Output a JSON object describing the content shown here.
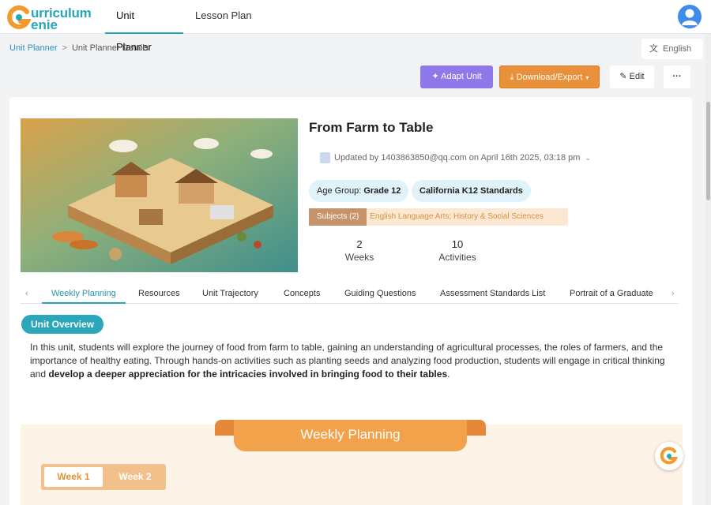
{
  "app": {
    "logo_line1": "urriculum",
    "logo_line2": "enie"
  },
  "nav": {
    "tabs": [
      {
        "label": "Unit Planner"
      },
      {
        "label": "Lesson Plan"
      }
    ]
  },
  "breadcrumb": {
    "root": "Unit Planner",
    "separator": ">",
    "current": "Unit Planner Details"
  },
  "language": {
    "label": "English"
  },
  "actions": {
    "adapt": "Adapt Unit",
    "export": "Download/Export",
    "edit": "Edit",
    "more": "···"
  },
  "unit": {
    "title": "From Farm to Table",
    "updated": "Updated by 1403863850@qq.com on April 16th 2025, 03:18 pm",
    "age_group_label": "Age Group:",
    "age_group_value": "Grade 12",
    "standards": "California K12 Standards",
    "subjects_tag": "Subjects (2)",
    "subjects_list": "English Language Arts; History & Social Sciences",
    "stats": [
      {
        "value": "2",
        "label": "Weeks"
      },
      {
        "value": "10",
        "label": "Activities"
      }
    ]
  },
  "tabs": [
    {
      "label": "Weekly Planning"
    },
    {
      "label": "Resources"
    },
    {
      "label": "Unit Trajectory"
    },
    {
      "label": "Concepts"
    },
    {
      "label": "Guiding Questions"
    },
    {
      "label": "Assessment Standards List"
    },
    {
      "label": "Portrait of a Graduate"
    }
  ],
  "overview": {
    "badge": "Unit Overview",
    "text_plain": "In this unit, students will explore the journey of food from farm to table, gaining an understanding of agricultural processes, the roles of farmers, and the importance of healthy eating. Through hands-on activities such as planting seeds and analyzing food production, students will engage in critical thinking and ",
    "text_bold": "develop a deeper appreciation for the intricacies involved in bringing food to their tables",
    "text_end": "."
  },
  "weekly": {
    "banner": "Weekly Planning",
    "weeks": [
      "Week 1",
      "Week 2"
    ]
  },
  "colors": {
    "brand_teal": "#27a6b8",
    "adapt_purple": "#8f78ea",
    "export_orange": "#e8913a"
  }
}
